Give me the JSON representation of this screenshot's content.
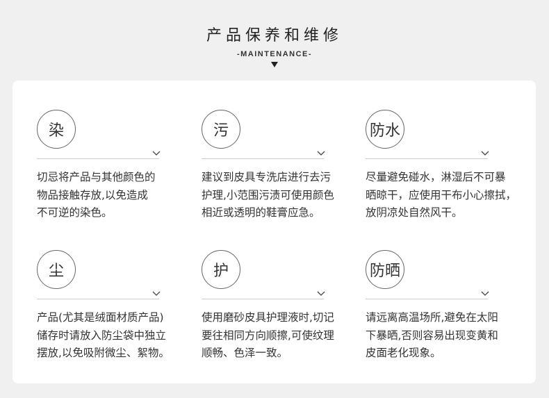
{
  "header": {
    "title": "产品保养和维修",
    "subtitle": "-MAINTENANCE-"
  },
  "items": [
    {
      "icon": "染",
      "icon_name": "dye-icon",
      "text": "切忌将产品与其他颜色的\n物品接触存放,以免造成\n不可逆的染色。"
    },
    {
      "icon": "污",
      "icon_name": "stain-icon",
      "text": "建议到皮具专洗店进行去污\n护理,小范围污渍可使用颜色\n相近或透明的鞋膏应急。"
    },
    {
      "icon": "防水",
      "icon_name": "waterproof-icon",
      "text": "尽量避免碰水，淋湿后不可暴\n晒晾干，应使用干布小心擦拭，\n放阴凉处自然风干。"
    },
    {
      "icon": "尘",
      "icon_name": "dust-icon",
      "text": "产品(尤其是绒面材质产品)\n储存时请放入防尘袋中独立\n摆放,以免吸附微尘、絮物。"
    },
    {
      "icon": "护",
      "icon_name": "care-icon",
      "text": "使用磨砂皮具护理液时,切记\n要往相同方向顺擦,可使纹理\n顺畅、色泽一致。"
    },
    {
      "icon": "防晒",
      "icon_name": "sun-protection-icon",
      "text": "请远离高温场所,避免在太阳\n下暴晒,否则容易出现变黄和\n皮面老化现象。"
    }
  ]
}
